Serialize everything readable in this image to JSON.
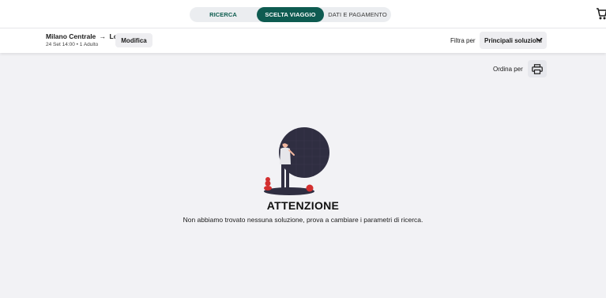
{
  "steps": [
    {
      "label": "RICERCA",
      "active": false
    },
    {
      "label": "SCELTA VIAGGIO",
      "active": true
    },
    {
      "label": "DATI E PAGAMENTO",
      "active": false
    }
  ],
  "colors": {
    "brand_green": "#0e5b51",
    "background": "#f2f2f5",
    "accent_red": "#d32f2f"
  },
  "trip": {
    "origin": "Milano Centrale",
    "arrow": "→",
    "destination": "Lodi",
    "meta": "24 Set 14:00 • 1 Adulto"
  },
  "buttons": {
    "modify": "Modifica"
  },
  "filter": {
    "label": "Filtra per",
    "selected": "Principali soluzioni"
  },
  "sort": {
    "label": "Ordina per"
  },
  "empty_state": {
    "title": "ATTENZIONE",
    "message": "Non abbiamo trovato nessuna soluzione, prova a cambiare i parametri di ricerca."
  },
  "icons": {
    "cart": "cart-icon",
    "chevron": "chevron-down-icon",
    "print": "print-icon"
  }
}
